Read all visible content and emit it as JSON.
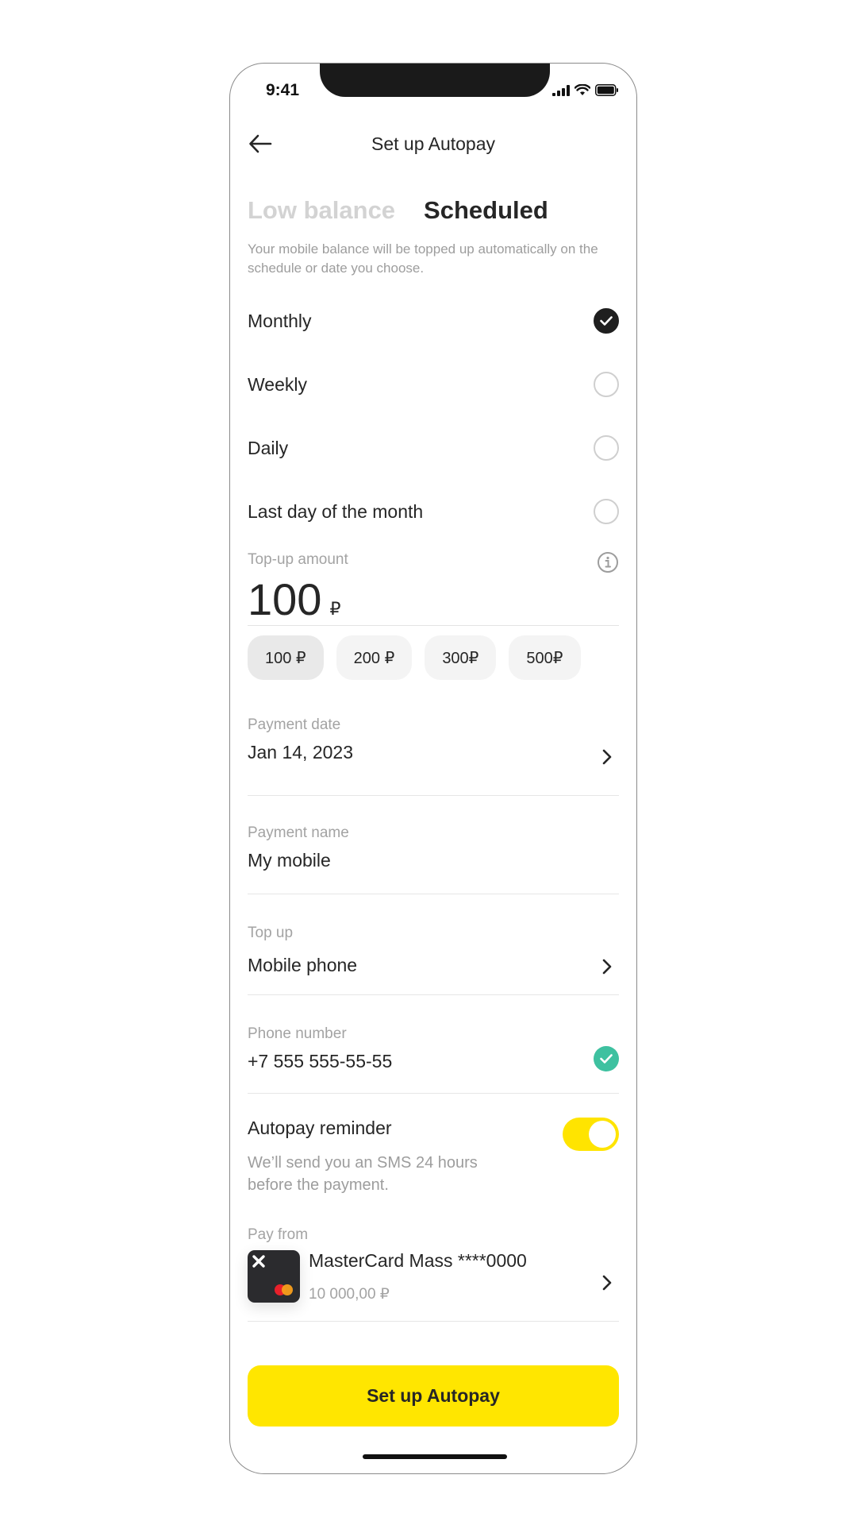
{
  "status_bar": {
    "time": "9:41"
  },
  "header": {
    "title": "Set up Autopay",
    "back_icon": "arrow-left-icon"
  },
  "tabs": [
    {
      "label": "Low balance",
      "active": false
    },
    {
      "label": "Scheduled",
      "active": true
    }
  ],
  "description": "Your mobile balance will be topped up automatically on the schedule or date you choose.",
  "schedule_options": [
    {
      "label": "Monthly",
      "selected": true
    },
    {
      "label": "Weekly",
      "selected": false
    },
    {
      "label": "Daily",
      "selected": false
    },
    {
      "label": "Last day of the month",
      "selected": false
    }
  ],
  "amount": {
    "label": "Top-up amount",
    "value": "100",
    "currency": "₽",
    "info_icon": "info-icon"
  },
  "quick_amounts": [
    {
      "label": "100 ₽",
      "selected": true
    },
    {
      "label": "200 ₽",
      "selected": false
    },
    {
      "label": "300₽",
      "selected": false
    },
    {
      "label": "500₽",
      "selected": false
    }
  ],
  "payment_date": {
    "label": "Payment date",
    "value": "Jan 14, 2023"
  },
  "payment_name": {
    "label": "Payment name",
    "value": "My mobile"
  },
  "top_up": {
    "label": "Top up",
    "value": "Mobile phone"
  },
  "phone_number": {
    "label": "Phone number",
    "value": "+7 555 555-55-55",
    "verified": true
  },
  "reminder": {
    "title": "Autopay reminder",
    "description": "We’ll send you an SMS 24 hours before the payment.",
    "enabled": true
  },
  "pay_from": {
    "label": "Pay from",
    "card_name": "MasterCard Mass ****0000",
    "balance": "10 000,00 ₽"
  },
  "cta": {
    "label": "Set up Autopay"
  },
  "colors": {
    "accent_yellow": "#ffe600",
    "success_green": "#3ec1a0",
    "text_dark": "#262626",
    "text_muted": "#9d9d9d"
  }
}
